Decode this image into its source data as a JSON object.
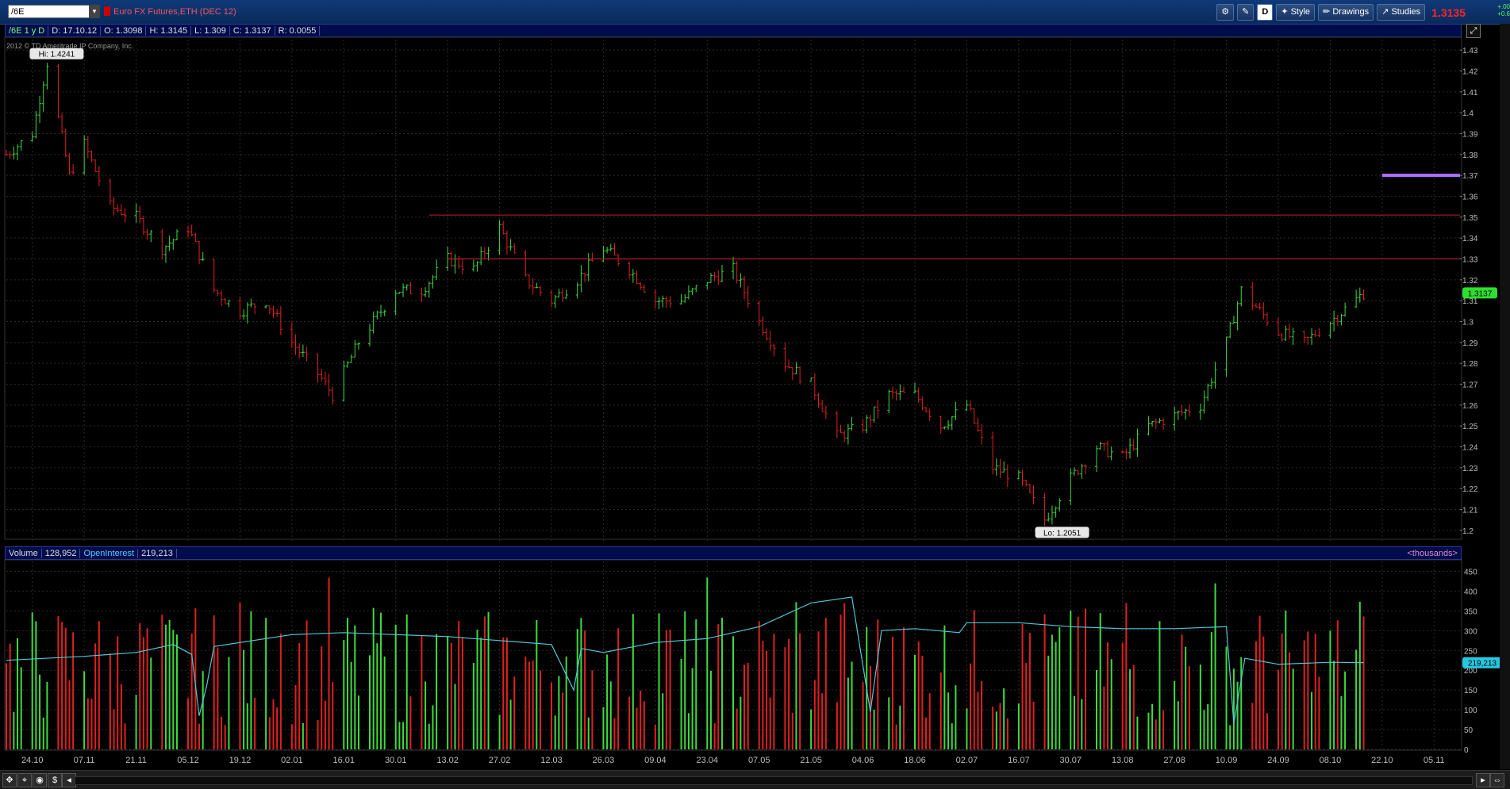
{
  "titlebar": {
    "symbol": "/6E",
    "title": "Euro FX Futures,ETH (DEC 12)",
    "d_label": "D",
    "style_label": "Style",
    "drawings_label": "Drawings",
    "studies_label": "Studies",
    "last_price": "1.3135",
    "change_a": "+.00",
    "change_b": "+0.6"
  },
  "info": {
    "symbol": "/6E 1 y D",
    "date": "D: 17.10.12",
    "open": "O: 1.3098",
    "high": "H: 1.3145",
    "low": "L: 1.309",
    "close": "C: 1.3137",
    "range": "R: 0.0055",
    "copyright": "2012 © TD Ameritrade IP Company, Inc."
  },
  "volume_header": {
    "volume_label": "Volume",
    "volume_value": "128,952",
    "oi_label": "OpenInterest",
    "oi_value": "219,213",
    "units": "<thousands>"
  },
  "colors": {
    "up": "#3ddc3d",
    "down": "#e02020",
    "oi": "#4ec8d8",
    "resistance": "#b02020",
    "target": "#b070ff",
    "grid": "#2a2a2a",
    "label_green": "#2de02d",
    "label_cyan": "#27c7e0"
  },
  "chart_data": [
    {
      "type": "candlestick",
      "title": "Euro FX Futures,ETH (DEC 12)",
      "price_ticks": [
        "1.43",
        "1.42",
        "1.41",
        "1.4",
        "1.39",
        "1.38",
        "1.37",
        "1.36",
        "1.35",
        "1.34",
        "1.33",
        "1.32",
        "1.31",
        "1.3",
        "1.29",
        "1.28",
        "1.27",
        "1.26",
        "1.25",
        "1.24",
        "1.23",
        "1.22",
        "1.21",
        "1.2"
      ],
      "ylim": [
        1.195,
        1.435
      ],
      "x_ticks": [
        "24.10",
        "07.11",
        "21.11",
        "05.12",
        "19.12",
        "02.01",
        "16.01",
        "30.01",
        "13.02",
        "27.02",
        "12.03",
        "26.03",
        "09.04",
        "23.04",
        "07.05",
        "21.05",
        "04.06",
        "18.06",
        "02.07",
        "16.07",
        "30.07",
        "13.08",
        "27.08",
        "10.09",
        "24.09",
        "08.10",
        "22.10",
        "05.11"
      ],
      "x_range": [
        "17.10.11",
        "12.11.12"
      ],
      "last_bar_date": "17.10.12",
      "series": [
        {
          "name": "/6E 1 y D",
          "close_path": [
            [
              "17.10.11",
              1.38
            ],
            [
              "24.10.11",
              1.39
            ],
            [
              "28.10.11",
              1.4241
            ],
            [
              "03.11.11",
              1.37
            ],
            [
              "07.11.11",
              1.385
            ],
            [
              "14.11.11",
              1.355
            ],
            [
              "21.11.11",
              1.35
            ],
            [
              "28.11.11",
              1.335
            ],
            [
              "05.12.11",
              1.345
            ],
            [
              "12.12.11",
              1.315
            ],
            [
              "19.12.11",
              1.305
            ],
            [
              "26.12.11",
              1.31
            ],
            [
              "02.01.12",
              1.29
            ],
            [
              "09.01.12",
              1.275
            ],
            [
              "13.01.12",
              1.265
            ],
            [
              "20.01.12",
              1.29
            ],
            [
              "30.01.12",
              1.315
            ],
            [
              "06.02.12",
              1.315
            ],
            [
              "13.02.12",
              1.33
            ],
            [
              "20.02.12",
              1.325
            ],
            [
              "27.02.12",
              1.345
            ],
            [
              "05.03.12",
              1.32
            ],
            [
              "12.03.12",
              1.31
            ],
            [
              "19.03.12",
              1.32
            ],
            [
              "26.03.12",
              1.335
            ],
            [
              "02.04.12",
              1.325
            ],
            [
              "09.04.12",
              1.31
            ],
            [
              "16.04.12",
              1.31
            ],
            [
              "23.04.12",
              1.32
            ],
            [
              "30.04.12",
              1.325
            ],
            [
              "07.05.12",
              1.3
            ],
            [
              "14.05.12",
              1.28
            ],
            [
              "21.05.12",
              1.27
            ],
            [
              "28.05.12",
              1.245
            ],
            [
              "04.06.12",
              1.25
            ],
            [
              "11.06.12",
              1.265
            ],
            [
              "18.06.12",
              1.265
            ],
            [
              "25.06.12",
              1.25
            ],
            [
              "02.07.12",
              1.26
            ],
            [
              "09.07.12",
              1.23
            ],
            [
              "16.07.12",
              1.225
            ],
            [
              "23.07.12",
              1.2051
            ],
            [
              "30.07.12",
              1.225
            ],
            [
              "06.08.12",
              1.24
            ],
            [
              "13.08.12",
              1.235
            ],
            [
              "20.08.12",
              1.25
            ],
            [
              "27.08.12",
              1.255
            ],
            [
              "03.09.12",
              1.26
            ],
            [
              "10.09.12",
              1.29
            ],
            [
              "14.09.12",
              1.315
            ],
            [
              "24.09.12",
              1.295
            ],
            [
              "01.10.12",
              1.29
            ],
            [
              "08.10.12",
              1.3
            ],
            [
              "17.10.12",
              1.3137
            ]
          ]
        }
      ],
      "annotations": {
        "high_label": "Hi: 1.4241",
        "low_label": "Lo: 1.2051",
        "current_label": "1.3137"
      },
      "horizontal_lines": [
        {
          "price": 1.351,
          "from": "08.02.12",
          "to": "12.11.12"
        },
        {
          "price": 1.33,
          "from": "13.02.12",
          "to": "12.11.12"
        },
        {
          "price": 1.37,
          "from": "22.10.12",
          "to": "12.11.12"
        }
      ]
    },
    {
      "type": "bar",
      "title": "Volume",
      "y_ticks": [
        "450",
        "400",
        "350",
        "300",
        "250",
        "200",
        "150",
        "100",
        "50",
        "0"
      ],
      "ylim": [
        0,
        475
      ],
      "open_interest_path": [
        [
          "17.10.11",
          225
        ],
        [
          "07.11.11",
          235
        ],
        [
          "21.11.11",
          245
        ],
        [
          "01.12.11",
          265
        ],
        [
          "06.12.11",
          240
        ],
        [
          "08.12.11",
          85
        ],
        [
          "10.12.11",
          160
        ],
        [
          "12.12.11",
          260
        ],
        [
          "02.01.12",
          290
        ],
        [
          "16.01.12",
          295
        ],
        [
          "30.01.12",
          290
        ],
        [
          "13.02.12",
          285
        ],
        [
          "27.02.12",
          275
        ],
        [
          "12.03.12",
          265
        ],
        [
          "18.03.12",
          150
        ],
        [
          "20.03.12",
          255
        ],
        [
          "26.03.12",
          245
        ],
        [
          "09.04.12",
          270
        ],
        [
          "23.04.12",
          280
        ],
        [
          "07.05.12",
          310
        ],
        [
          "21.05.12",
          370
        ],
        [
          "01.06.12",
          385
        ],
        [
          "06.06.12",
          95
        ],
        [
          "09.06.12",
          300
        ],
        [
          "18.06.12",
          305
        ],
        [
          "30.06.12",
          295
        ],
        [
          "02.07.12",
          320
        ],
        [
          "16.07.12",
          320
        ],
        [
          "30.07.12",
          310
        ],
        [
          "13.08.12",
          305
        ],
        [
          "27.08.12",
          305
        ],
        [
          "10.09.12",
          310
        ],
        [
          "12.09.12",
          65
        ],
        [
          "15.09.12",
          230
        ],
        [
          "24.09.12",
          215
        ],
        [
          "08.10.12",
          220
        ],
        [
          "17.10.12",
          219.213
        ]
      ],
      "annotations": {
        "current_label": "219,213"
      }
    }
  ]
}
